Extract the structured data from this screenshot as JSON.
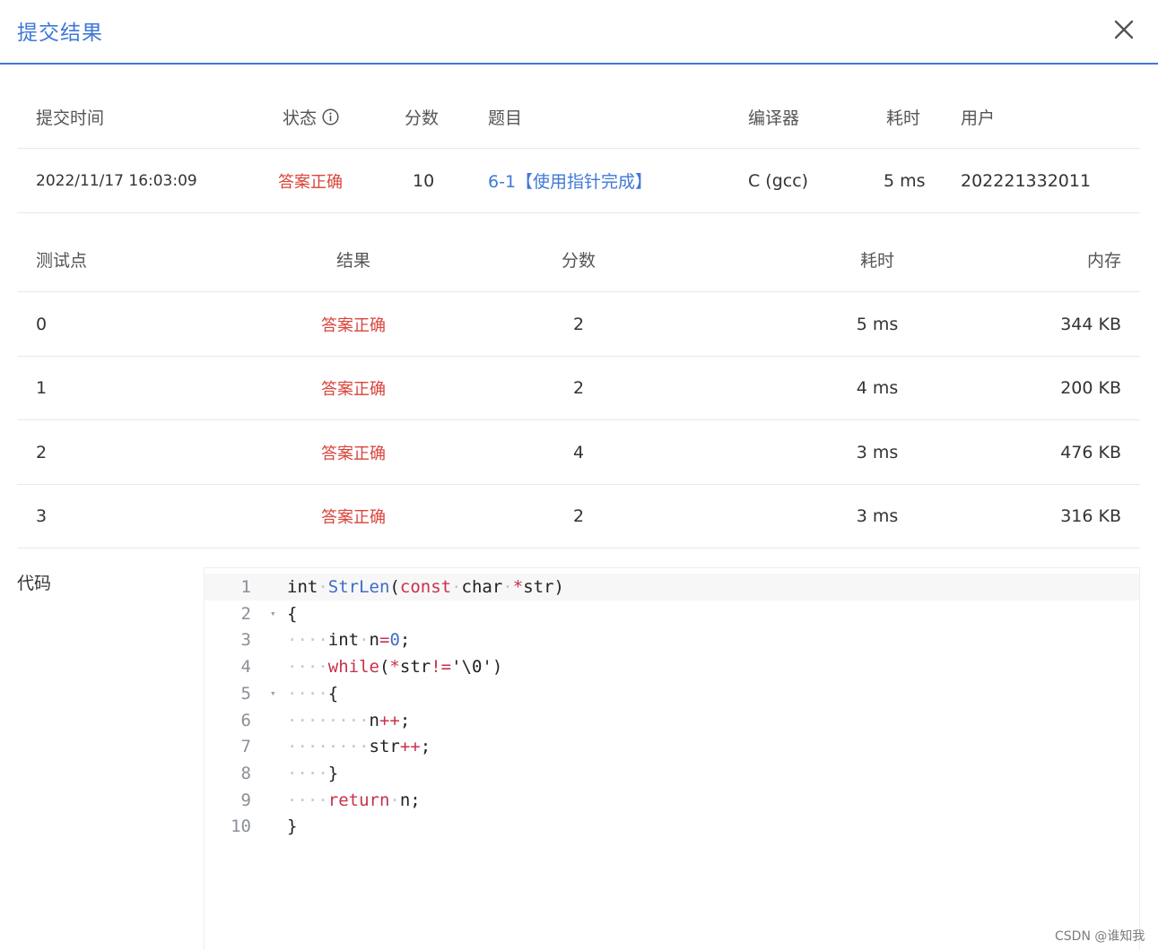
{
  "dialog": {
    "title": "提交结果",
    "close_icon": "close-icon"
  },
  "summary": {
    "headers": {
      "time": "提交时间",
      "status": "状态",
      "score": "分数",
      "problem": "题目",
      "compiler": "编译器",
      "elapsed": "耗时",
      "user": "用户"
    },
    "status_info_icon": "info-icon",
    "row": {
      "time": "2022/11/17 16:03:09",
      "status": "答案正确",
      "score": "10",
      "problem": "6-1【使用指针完成】",
      "compiler": "C (gcc)",
      "elapsed": "5 ms",
      "user": "202221332011"
    },
    "status_color": "#d9443a",
    "link_color": "#3f78d6"
  },
  "tests": {
    "headers": {
      "case": "测试点",
      "result": "结果",
      "score": "分数",
      "elapsed": "耗时",
      "memory": "内存"
    },
    "rows": [
      {
        "case": "0",
        "result": "答案正确",
        "score": "2",
        "elapsed": "5 ms",
        "memory": "344 KB"
      },
      {
        "case": "1",
        "result": "答案正确",
        "score": "2",
        "elapsed": "4 ms",
        "memory": "200 KB"
      },
      {
        "case": "2",
        "result": "答案正确",
        "score": "4",
        "elapsed": "3 ms",
        "memory": "476 KB"
      },
      {
        "case": "3",
        "result": "答案正确",
        "score": "2",
        "elapsed": "3 ms",
        "memory": "316 KB"
      }
    ]
  },
  "code": {
    "label": "代码",
    "lines": [
      {
        "n": "1",
        "text": "int StrLen(const char *str)"
      },
      {
        "n": "2",
        "text": "{"
      },
      {
        "n": "3",
        "text": "    int n=0;"
      },
      {
        "n": "4",
        "text": "    while(*str!='\\0')"
      },
      {
        "n": "5",
        "text": "    {"
      },
      {
        "n": "6",
        "text": "        n++;"
      },
      {
        "n": "7",
        "text": "        str++;"
      },
      {
        "n": "8",
        "text": "    }"
      },
      {
        "n": "9",
        "text": "    return n;"
      },
      {
        "n": "10",
        "text": "}"
      }
    ]
  },
  "watermark": "CSDN @谁知我"
}
